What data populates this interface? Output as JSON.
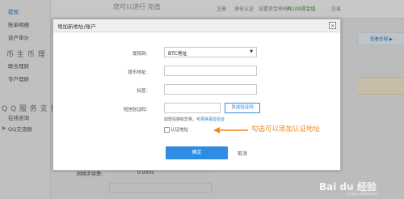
{
  "background": {
    "top_hint": "您可以进行 充值",
    "nav": [
      "注册",
      "身份认证",
      "设置资金密码",
      "再100提金值",
      "交易"
    ],
    "sidebar": {
      "items": [
        "提现",
        "账单明细",
        "资产审计"
      ],
      "section1": "币 生 币 理",
      "section1_items": [
        "联合理财",
        "专户理财"
      ],
      "section2": "Q Q 服 务 支 持",
      "section2_items": [
        "在线咨询",
        "QQ交流群"
      ]
    },
    "right_link": "查看全部 ▶",
    "fee_label": "网络手续费:",
    "fee_value": "0.0005"
  },
  "modal": {
    "title": "增加新地址/账户",
    "close": "×",
    "fields": {
      "currency_label": "提现到：",
      "currency_value": "BTC地址",
      "address_label": "提币地址：",
      "tag_label": "标签：",
      "sms_label": "短信验证码："
    },
    "send_code": "发送验证码",
    "sms_hint": "如短信接收异常，可",
    "sms_hint_link": "更换语音验证",
    "verify_checkbox_label": "认证地址",
    "annotation": "勾选可以添加认证地址",
    "confirm": "确定",
    "cancel": "取消"
  },
  "watermark": "Bai du 经验",
  "watermark_sub": "jingyan.baidu.com",
  "colors": {
    "primary": "#2d8de3",
    "annotation": "#f08a1a",
    "link": "#2a7fd4"
  }
}
